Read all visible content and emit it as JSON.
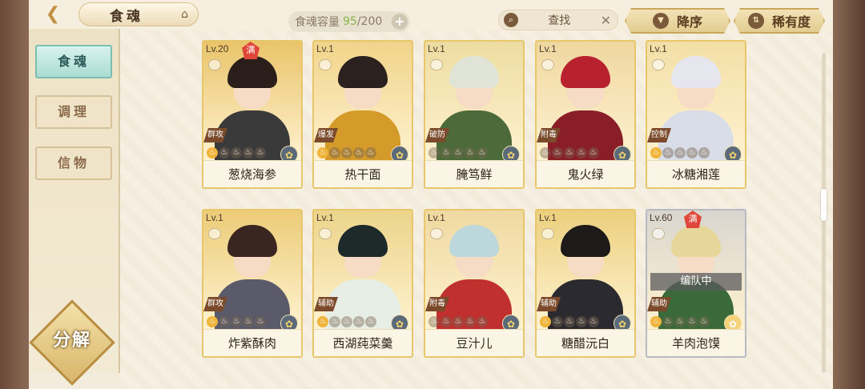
{
  "header": {
    "title": "食魂",
    "capacity_label": "食魂容量",
    "capacity_current": "95",
    "capacity_max": "/200",
    "search_label": "查找",
    "sort_desc_label": "降序",
    "sort_rarity_label": "稀有度"
  },
  "sidebar": {
    "items": [
      {
        "label": "食魂"
      },
      {
        "label": "调理"
      },
      {
        "label": "信物"
      }
    ],
    "decompose_label": "分解"
  },
  "cards": [
    {
      "level": "Lv.20",
      "maxed": true,
      "full_label": "满",
      "role": "群攻",
      "stars_on": 1,
      "name": "葱烧海参",
      "hair": "#2a1e1a",
      "body": "#3a3a3a",
      "bg": "#e9c46a",
      "squad": ""
    },
    {
      "level": "Lv.1",
      "maxed": false,
      "full_label": "",
      "role": "爆发",
      "stars_on": 1,
      "name": "热干面",
      "hair": "#2b2220",
      "body": "#d49a2a",
      "bg": "#f1d48a",
      "squad": ""
    },
    {
      "level": "Lv.1",
      "maxed": false,
      "full_label": "",
      "role": "破防",
      "stars_on": 0,
      "name": "腌笃鲜",
      "hair": "#dfe4d6",
      "body": "#4d6a3a",
      "bg": "#eddca0",
      "squad": ""
    },
    {
      "level": "Lv.1",
      "maxed": false,
      "full_label": "",
      "role": "附毒",
      "stars_on": 0,
      "name": "鬼火绿",
      "hair": "#b8222e",
      "body": "#8a1e28",
      "bg": "#efd7a0",
      "squad": ""
    },
    {
      "level": "Lv.1",
      "maxed": false,
      "full_label": "",
      "role": "控制",
      "stars_on": 1,
      "name": "冰糖湘莲",
      "hair": "#e6e6ee",
      "body": "#d8dde8",
      "bg": "#f2dfa6",
      "squad": ""
    },
    {
      "level": "Lv.1",
      "maxed": false,
      "full_label": "",
      "role": "群攻",
      "stars_on": 1,
      "name": "炸紫酥肉",
      "hair": "#3a2620",
      "body": "#5a5a6a",
      "bg": "#eccc78",
      "squad": ""
    },
    {
      "level": "Lv.1",
      "maxed": false,
      "full_label": "",
      "role": "辅助",
      "stars_on": 1,
      "name": "西湖莼菜羹",
      "hair": "#1e2a2a",
      "body": "#e7eee6",
      "bg": "#ecd48a",
      "squad": ""
    },
    {
      "level": "Lv.1",
      "maxed": false,
      "full_label": "",
      "role": "附毒",
      "stars_on": 0,
      "name": "豆汁儿",
      "hair": "#bcd8dc",
      "body": "#c0302e",
      "bg": "#efd9a0",
      "squad": ""
    },
    {
      "level": "Lv.1",
      "maxed": false,
      "full_label": "",
      "role": "辅助",
      "stars_on": 1,
      "name": "糖醋沅白",
      "hair": "#1e1a1a",
      "body": "#2a2a30",
      "bg": "#ecd07e",
      "squad": ""
    },
    {
      "level": "Lv.60",
      "maxed": true,
      "full_label": "满",
      "role": "辅助",
      "stars_on": 1,
      "name": "羊肉泡馍",
      "hair": "#e6d69a",
      "body": "#3a6a3a",
      "bg": "#d9d6d0",
      "squad": "编队中"
    }
  ]
}
